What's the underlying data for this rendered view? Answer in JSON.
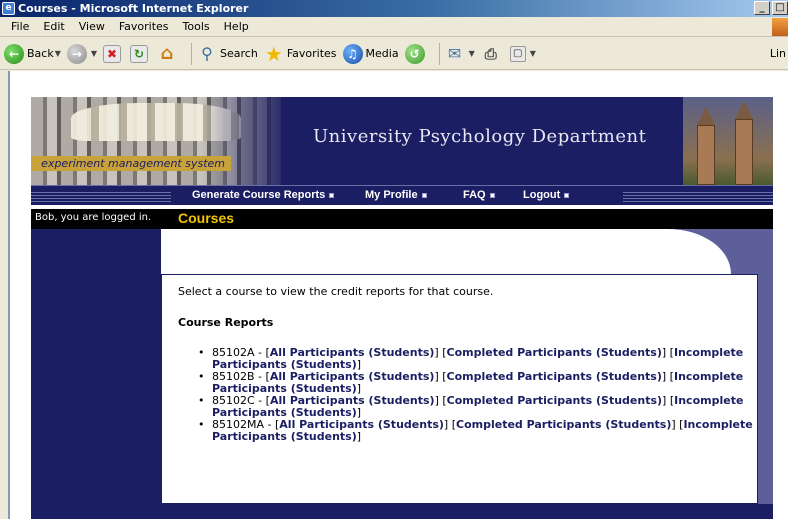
{
  "window": {
    "title": "Courses - Microsoft Internet Explorer",
    "icon": "ie-icon",
    "buttons": [
      "_",
      "□"
    ]
  },
  "menu": [
    "File",
    "Edit",
    "View",
    "Favorites",
    "Tools",
    "Help"
  ],
  "toolbar": {
    "back_label": "Back",
    "search_label": "Search",
    "favorites_label": "Favorites",
    "media_label": "Media",
    "links_label": "Lin"
  },
  "banner": {
    "system_label": "experiment management system",
    "department": "University Psychology Department"
  },
  "nav": [
    "Generate Course Reports",
    "My Profile",
    "FAQ",
    "Logout"
  ],
  "page": {
    "login_status": "Bob, you are logged in.",
    "title": "Courses",
    "intro": "Select a course to view the credit reports for that course.",
    "section_heading": "Course Reports"
  },
  "courses": [
    {
      "code": "85102A",
      "all": "All Participants (Students)",
      "completed": "Completed Participants (Students)",
      "incomplete": "Incomplete Participants (Students)"
    },
    {
      "code": "85102B",
      "all": "All Participants (Students)",
      "completed": "Completed Participants (Students)",
      "incomplete": "Incomplete Participants (Students)"
    },
    {
      "code": "85102C",
      "all": "All Participants (Students)",
      "completed": "Completed Participants (Students)",
      "incomplete": "Incomplete Participants (Students)"
    },
    {
      "code": "85102MA",
      "all": "All Participants (Students)",
      "completed": "Completed Participants (Students)",
      "incomplete": "Incomplete Participants (Students)"
    }
  ],
  "colors": {
    "navy": "#1b1e62",
    "gold_title": "#f2c400",
    "purple_panel": "#5c5f9a"
  }
}
